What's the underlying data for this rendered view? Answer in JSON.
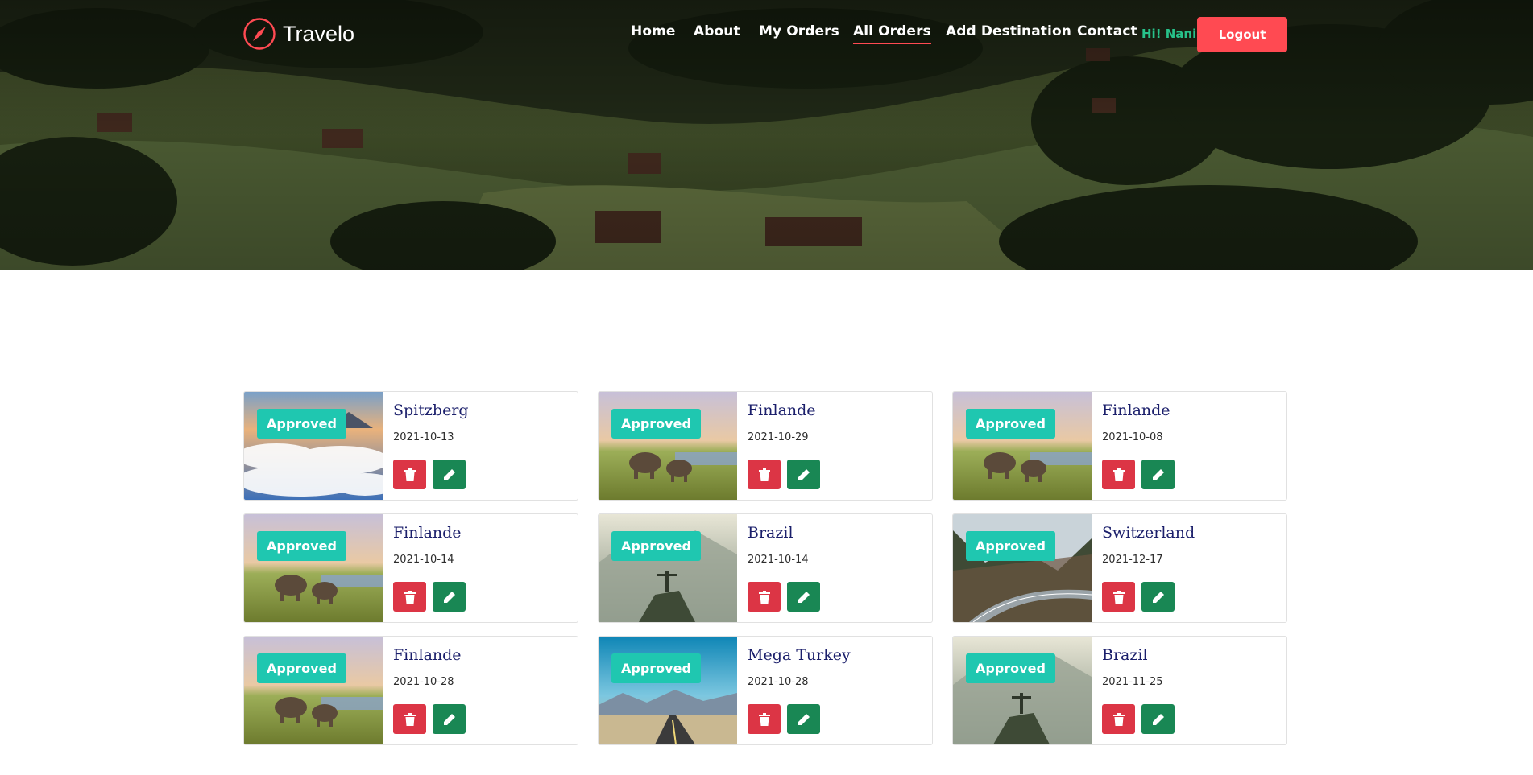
{
  "brand": {
    "name": "Travelo"
  },
  "nav": {
    "items": [
      {
        "label": "Home",
        "active": false
      },
      {
        "label": "About",
        "active": false
      },
      {
        "label": "My Orders",
        "active": false
      },
      {
        "label": "All Orders",
        "active": true
      },
      {
        "label": "Add Destination",
        "active": false
      },
      {
        "label": "Contact",
        "active": false
      }
    ],
    "greeting": "Hi! Nani",
    "logout_label": "Logout"
  },
  "colors": {
    "accent": "#ff4a52",
    "badge": "#1fc7b0",
    "delete": "#dc3545",
    "edit": "#198754",
    "greeting": "#27c28a",
    "title": "#1b1f6b"
  },
  "orders": [
    {
      "destination": "Spitzberg",
      "date": "2021-10-13",
      "status": "Approved",
      "image": "clouds-mountains"
    },
    {
      "destination": "Finlande",
      "date": "2021-10-29",
      "status": "Approved",
      "image": "elephants-savanna"
    },
    {
      "destination": "Finlande",
      "date": "2021-10-08",
      "status": "Approved",
      "image": "elephants-savanna"
    },
    {
      "destination": "Finlande",
      "date": "2021-10-14",
      "status": "Approved",
      "image": "elephants-savanna"
    },
    {
      "destination": "Brazil",
      "date": "2021-10-14",
      "status": "Approved",
      "image": "christ-mountain"
    },
    {
      "destination": "Switzerland",
      "date": "2021-12-17",
      "status": "Approved",
      "image": "forest-road"
    },
    {
      "destination": "Finlande",
      "date": "2021-10-28",
      "status": "Approved",
      "image": "elephants-savanna"
    },
    {
      "destination": "Mega Turkey",
      "date": "2021-10-28",
      "status": "Approved",
      "image": "desert-road"
    },
    {
      "destination": "Brazil",
      "date": "2021-11-25",
      "status": "Approved",
      "image": "christ-mountain"
    }
  ],
  "icons": {
    "delete": "trash-icon",
    "edit": "pencil-icon",
    "logo": "compass-icon"
  }
}
